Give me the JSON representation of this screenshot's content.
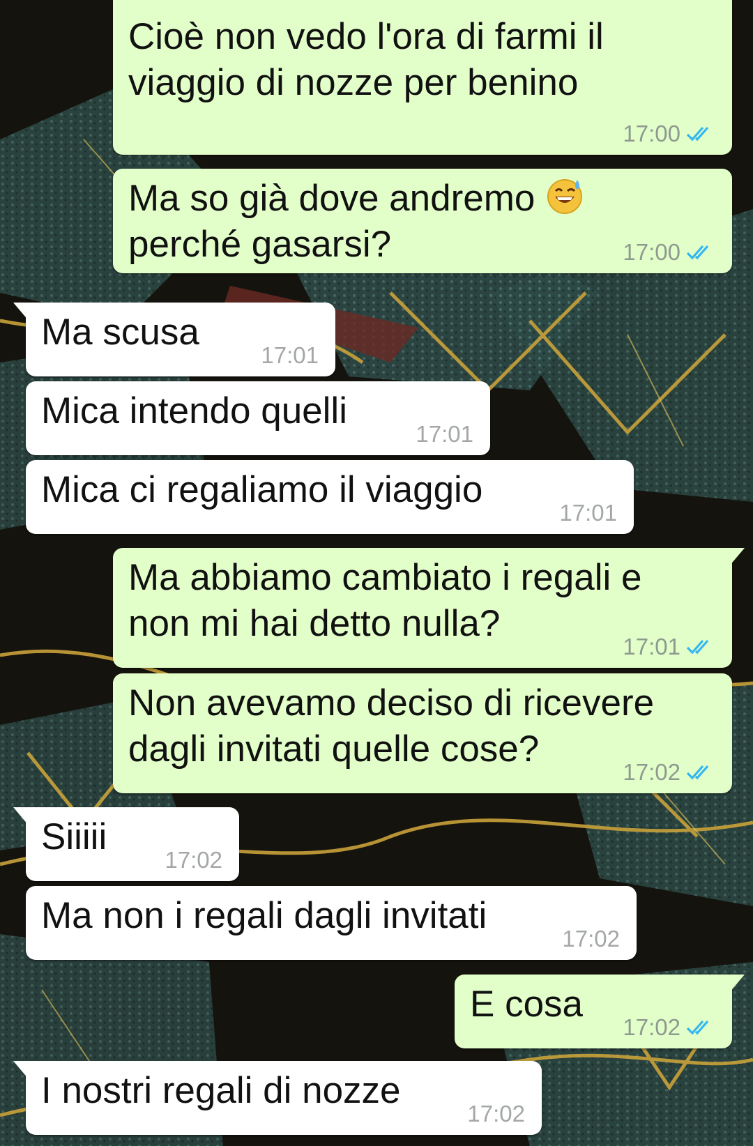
{
  "colors": {
    "outgoing_bubble": "#e2fec9",
    "incoming_bubble": "#ffffff",
    "read_ticks": "#34b7f1",
    "time_text": "#8e9a90"
  },
  "wallpaper": {
    "description_icon": "temple-rooftops-wallpaper"
  },
  "messages": [
    {
      "direction": "out",
      "text": "Cioè non vedo l'ora di farmi il\nviaggio di nozze per benino",
      "time": "17:00",
      "status_icon": "double-check-icon"
    },
    {
      "direction": "out",
      "text": "Ma so già dove andremo",
      "text2": "perché gasarsi?",
      "emoji_icon": "grinning-sweat-emoji",
      "time": "17:00",
      "status_icon": "double-check-icon"
    },
    {
      "direction": "in",
      "text": "Ma scusa",
      "time": "17:01"
    },
    {
      "direction": "in",
      "text": "Mica intendo quelli",
      "time": "17:01"
    },
    {
      "direction": "in",
      "text": "Mica ci regaliamo il viaggio",
      "time": "17:01"
    },
    {
      "direction": "out",
      "text": "Ma abbiamo cambiato i regali e\nnon mi hai detto nulla?",
      "time": "17:01",
      "status_icon": "double-check-icon"
    },
    {
      "direction": "out",
      "text": "Non avevamo deciso di ricevere\ndagli invitati quelle cose?",
      "time": "17:02",
      "status_icon": "double-check-icon"
    },
    {
      "direction": "in",
      "text": "Siiiii",
      "time": "17:02"
    },
    {
      "direction": "in",
      "text": "Ma non i regali dagli invitati",
      "time": "17:02"
    },
    {
      "direction": "out",
      "text": "E cosa",
      "time": "17:02",
      "status_icon": "double-check-icon"
    },
    {
      "direction": "in",
      "text": "I nostri regali di nozze",
      "time": "17:02"
    }
  ]
}
